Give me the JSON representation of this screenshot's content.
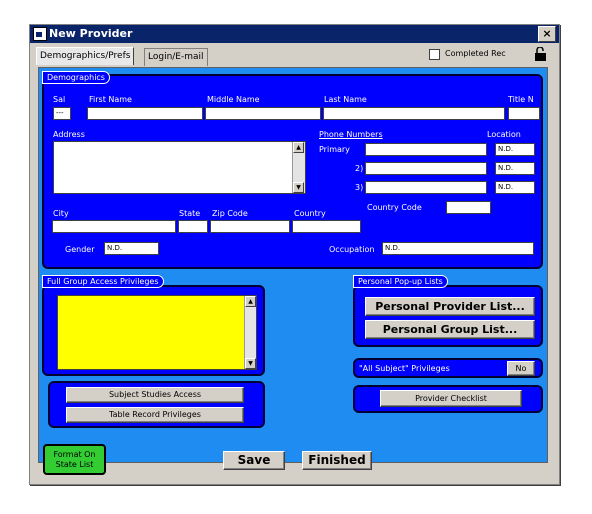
{
  "window": {
    "title": "New Provider",
    "close_glyph": "×"
  },
  "tabs": [
    {
      "label": "Demographics/Prefs",
      "active": true
    },
    {
      "label": "Login/E-mail",
      "active": false
    }
  ],
  "completed_rec": {
    "label": "Completed Rec",
    "checked": false
  },
  "demographics": {
    "title": "Demographics",
    "labels": {
      "sal": "Sal",
      "first": "First Name",
      "middle": "Middle Name",
      "last": "Last Name",
      "title_n": "Title N",
      "address": "Address",
      "phone_numbers": "Phone Numbers",
      "location": "Location",
      "primary": "Primary",
      "p2": "2)",
      "p3": "3)",
      "country_code": "Country Code",
      "city": "City",
      "state": "State",
      "zip": "Zip Code",
      "country": "Country",
      "gender": "Gender",
      "occupation": "Occupation"
    },
    "values": {
      "sal": "---",
      "first": "",
      "middle": "",
      "last": "",
      "title_n": "",
      "address": "",
      "primary": "",
      "p2": "",
      "p3": "",
      "loc1": "N.D.",
      "loc2": "N.D.",
      "loc3": "N.D.",
      "country_code": "",
      "city": "",
      "state": "",
      "zip": "",
      "country": "",
      "gender": "N.D.",
      "occupation": "N.D."
    }
  },
  "group_access": {
    "title": "Full Group Access Privileges",
    "list_color": "#ffff00"
  },
  "personal_lists": {
    "title": "Personal Pop-up Lists",
    "provider_list": "Personal Provider List...",
    "group_list": "Personal Group List..."
  },
  "all_subject": {
    "label": "\"All Subject\" Privileges",
    "value": "No"
  },
  "buttons": {
    "subject_studies": "Subject Studies Access",
    "table_record": "Table Record Privileges",
    "provider_checklist": "Provider Checklist",
    "save": "Save",
    "finished": "Finished",
    "format_line1": "Format On",
    "format_line2": "State List"
  },
  "colors": {
    "main_bg": "#1e8cf0",
    "panel_bg": "#0000ff",
    "format_btn": "#33cc33",
    "title_bar": "#0a246a"
  }
}
